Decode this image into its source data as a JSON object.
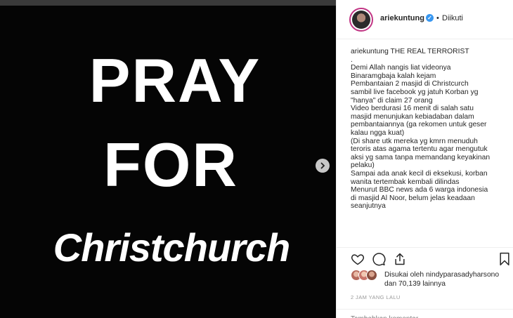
{
  "post_image": {
    "line1": "PRAY",
    "line2": "FOR",
    "line3": "Christchurch"
  },
  "header": {
    "username": "ariekuntung",
    "separator": "•",
    "follow_status": "Diikuti"
  },
  "caption": {
    "username": "ariekuntung",
    "lines": [
      "THE REAL TERRORIST",
      ".",
      "Demi Allah nangis liat videonya",
      "Binaramgbaja kalah kejam",
      "Pembantaian 2 masjid di Christcurch",
      "sambil live facebook yg jatuh Korban yg",
      "\"hanya\" di claim 27 orang",
      "Video berdurasi 16 menit di salah satu",
      "masjid menunjukan kebiadaban dalam",
      "pembantaiannya (ga rekomen untuk geser",
      "kalau ngga kuat)",
      "(Di share utk mereka yg kmrn menuduh",
      "teroris atas agama tertentu agar mengutuk",
      "aksi yg sama tanpa memandang keyakinan",
      "pelaku)",
      "Sampai ada anak kecil di eksekusi, korban",
      "wanita tertembak kembali dilindas",
      "Menurut BBC news ada 6 warga indonesia",
      "di masjid Al Noor, belum jelas keadaan",
      "seanjutnya"
    ]
  },
  "likes": {
    "line1": "Disukai oleh nindyparasadyharsono",
    "line2": "dan 70,139 lainnya"
  },
  "timestamp": "2 JAM YANG LALU",
  "comment": {
    "placeholder": "Tambahkan komentar..."
  },
  "icons": {
    "next": "chevron-right-icon",
    "like": "heart-icon",
    "comment": "comment-icon",
    "share": "share-icon",
    "save": "bookmark-icon",
    "verified": "verified-badge-icon"
  },
  "colors": {
    "verified": "#3897f0",
    "media_bg": "#050505",
    "muted": "#999999"
  }
}
